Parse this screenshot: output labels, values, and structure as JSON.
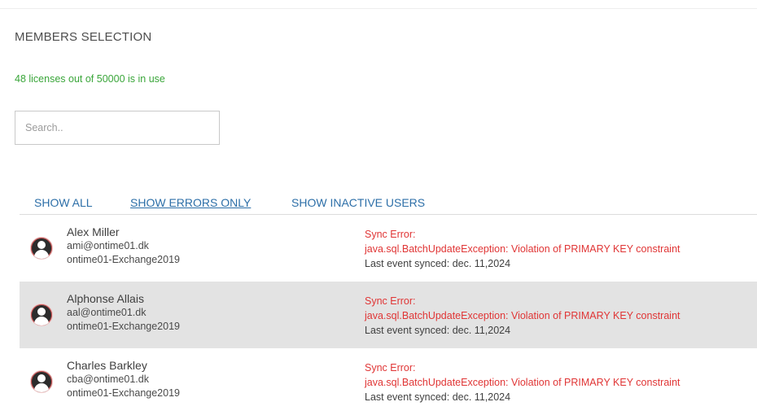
{
  "header": {
    "title": "MEMBERS SELECTION"
  },
  "license": {
    "text": "48 licenses out of 50000 is in use",
    "color": "#3aa63a"
  },
  "search": {
    "placeholder": "Search..",
    "value": ""
  },
  "filters": [
    {
      "label": "SHOW ALL",
      "active": false
    },
    {
      "label": "SHOW ERRORS ONLY",
      "active": true
    },
    {
      "label": "SHOW INACTIVE USERS",
      "active": false
    }
  ],
  "members": [
    {
      "name": "Alex Miller",
      "email": "ami@ontime01.dk",
      "server": "ontime01-Exchange2019",
      "status_title": "Sync Error:",
      "status_message": "java.sql.BatchUpdateException: Violation of PRIMARY KEY constraint",
      "last_synced": "Last event synced: dec. 11,2024"
    },
    {
      "name": "Alphonse Allais",
      "email": "aal@ontime01.dk",
      "server": "ontime01-Exchange2019",
      "status_title": "Sync Error:",
      "status_message": "java.sql.BatchUpdateException: Violation of PRIMARY KEY constraint",
      "last_synced": "Last event synced: dec. 11,2024"
    },
    {
      "name": "Charles Barkley",
      "email": "cba@ontime01.dk",
      "server": "ontime01-Exchange2019",
      "status_title": "Sync Error:",
      "status_message": "java.sql.BatchUpdateException: Violation of PRIMARY KEY constraint",
      "last_synced": "Last event synced: dec. 11,2024"
    }
  ],
  "icons": {
    "avatar": "user-avatar-icon"
  },
  "colors": {
    "error": "#e03535",
    "link": "#2d6fa8",
    "highlight_row": "#e3e3e3"
  }
}
